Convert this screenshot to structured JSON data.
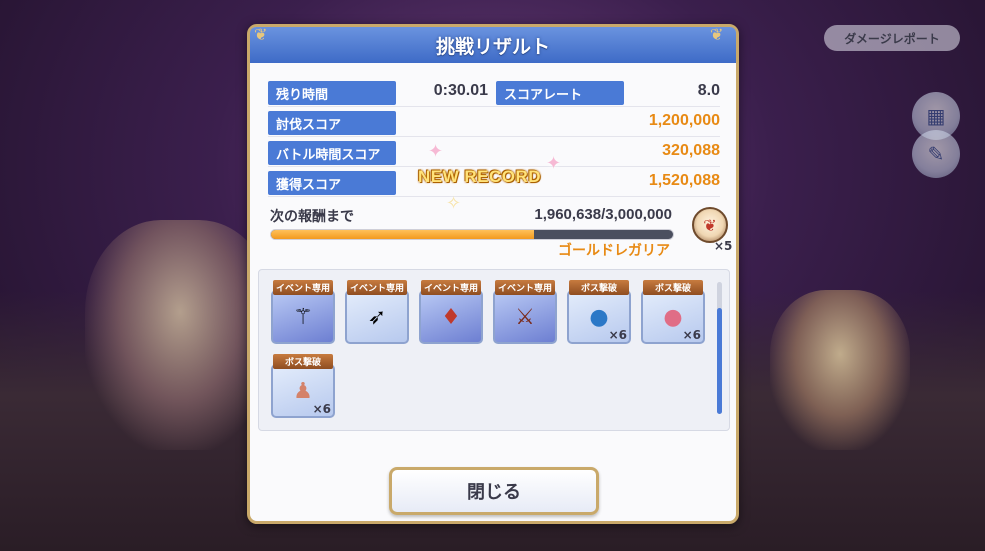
{
  "damage_report_label": "ダメージレポート",
  "dialog": {
    "title": "挑戦リザルト",
    "rows": [
      {
        "label": "残り時間",
        "value": "0:30.01"
      },
      {
        "label": "スコアレート",
        "value": "8.0"
      },
      {
        "label": "討伐スコア",
        "value": "1,200,000"
      },
      {
        "label": "バトル時間スコア",
        "value": "320,088"
      },
      {
        "label": "獲得スコア",
        "value": "1,520,088"
      }
    ],
    "new_record": "NEW RECORD",
    "next_reward_label": "次の報酬まで",
    "next_reward_value": "1,960,638/3,000,000",
    "next_reward_progress": 0.654,
    "reward_name": "ゴールドレガリア",
    "reward_count": "×5",
    "items": [
      {
        "badge": "イベント専用",
        "count": "",
        "icon": "staff-icon"
      },
      {
        "badge": "イベント専用",
        "count": "",
        "icon": "bow-icon"
      },
      {
        "badge": "イベント専用",
        "count": "",
        "icon": "armor-icon"
      },
      {
        "badge": "イベント専用",
        "count": "",
        "icon": "rod-icon"
      },
      {
        "badge": "ボス撃破",
        "count": "×6",
        "icon": "blue-orb-icon"
      },
      {
        "badge": "ボス撃破",
        "count": "×6",
        "icon": "pink-orb-icon"
      },
      {
        "badge": "ボス撃破",
        "count": "×6",
        "icon": "statue-icon"
      }
    ],
    "close_label": "閉じる"
  },
  "colors": {
    "accent_blue": "#4a7ad6",
    "score_orange": "#e88a14",
    "frame_gold": "#c9a96a"
  }
}
